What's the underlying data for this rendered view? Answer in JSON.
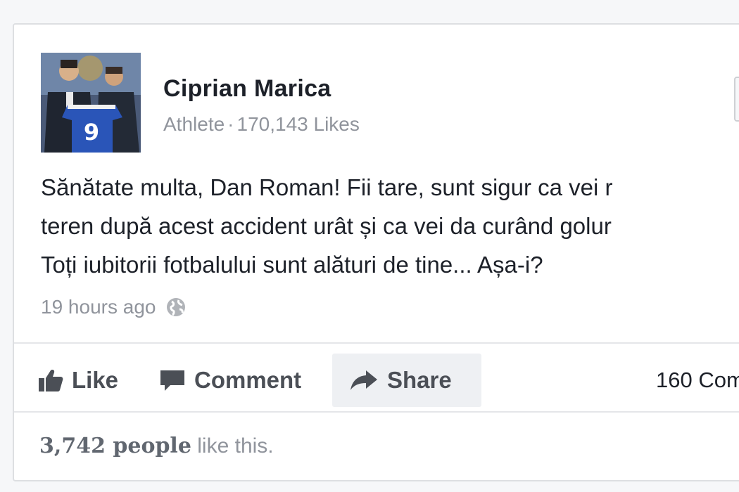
{
  "page": {
    "name": "Ciprian Marica",
    "category": "Athlete",
    "separator": "·",
    "likes": "170,143 Likes",
    "avatar_shirt_number": "9"
  },
  "post": {
    "text": "Sănătate multa, Dan Roman! Fii tare, sunt sigur ca vei r\nteren după acest accident urât și ca vei da curând golur\nToți iubitorii fotbalului sunt alături de tine... Așa-i?",
    "timestamp": "19 hours ago",
    "privacy_icon": "globe-icon"
  },
  "actions": {
    "like_label": "Like",
    "comment_label": "Comment",
    "share_label": "Share",
    "comment_count": "160 Com"
  },
  "reactions": {
    "count": "3,742 people",
    "suffix": " like this."
  },
  "colors": {
    "text": "#1d2129",
    "secondary": "#90949c",
    "action": "#4b4f56",
    "border": "#dddfe2"
  }
}
